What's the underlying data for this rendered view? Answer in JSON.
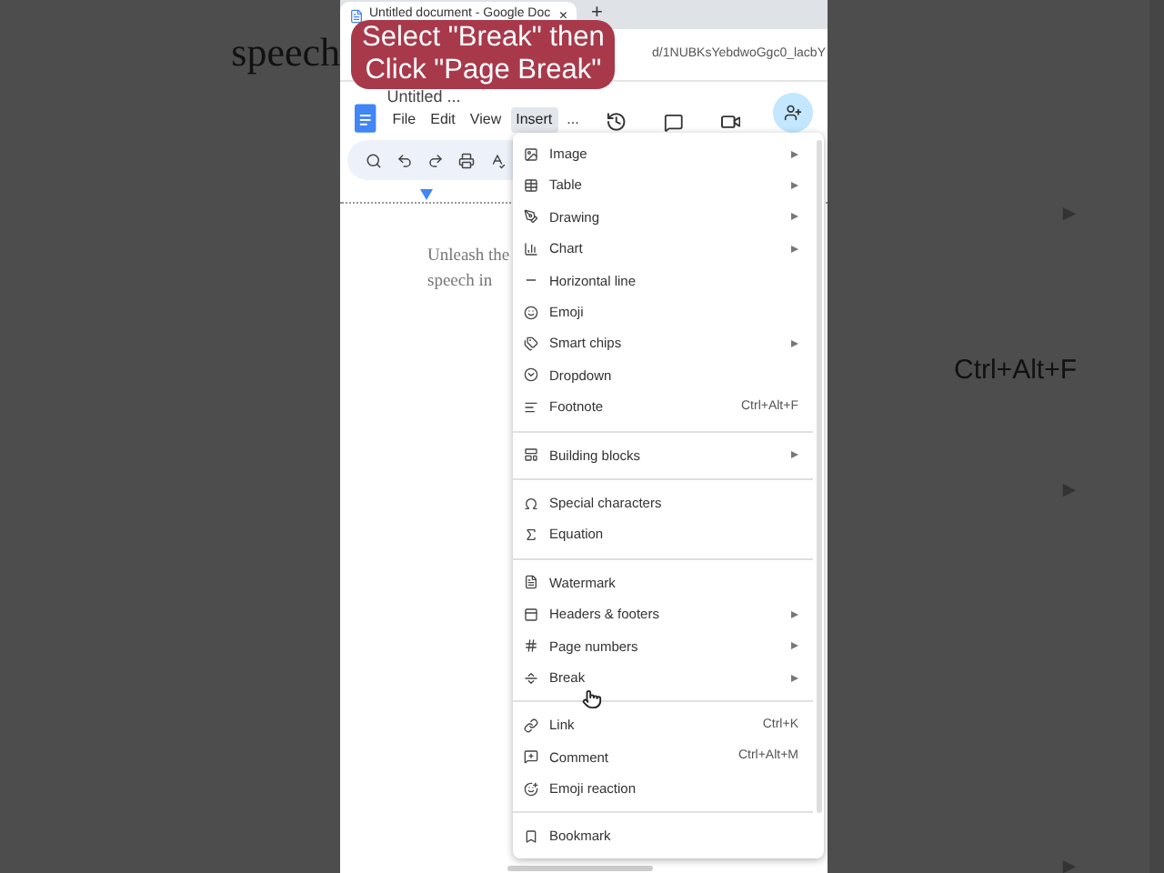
{
  "background": {
    "left_text": "speech",
    "right_shortcut": "Ctrl+Alt+F"
  },
  "browser": {
    "tab_title": "Untitled document - Google Doc",
    "tab_close": "×",
    "new_tab": "+",
    "address": "d/1NUBKsYebdwoGgc0_lacbY"
  },
  "caption": [
    "Select \"Break\" then",
    "Click \"Page Break\""
  ],
  "docs": {
    "title": "Untitled ...",
    "menus": [
      {
        "label": "File",
        "selected": false
      },
      {
        "label": "Edit",
        "selected": false
      },
      {
        "label": "View",
        "selected": false
      },
      {
        "label": "Insert",
        "selected": true
      },
      {
        "label": "...",
        "selected": false
      }
    ]
  },
  "document": {
    "lines": [
      "Unleash the",
      "speech in"
    ]
  },
  "insert_menu": {
    "groups": [
      [
        {
          "label": "Image",
          "submenu": true
        },
        {
          "label": "Table",
          "submenu": true
        },
        {
          "label": "Drawing",
          "submenu": true
        },
        {
          "label": "Chart",
          "submenu": true
        },
        {
          "label": "Horizontal line",
          "submenu": false
        },
        {
          "label": "Emoji",
          "submenu": false
        },
        {
          "label": "Smart chips",
          "submenu": true
        },
        {
          "label": "Dropdown",
          "submenu": false
        },
        {
          "label": "Footnote",
          "submenu": false,
          "shortcut": "Ctrl+Alt+F"
        }
      ],
      [
        {
          "label": "Building blocks",
          "submenu": true
        }
      ],
      [
        {
          "label": "Special characters",
          "submenu": false
        },
        {
          "label": "Equation",
          "submenu": false
        }
      ],
      [
        {
          "label": "Watermark",
          "submenu": false
        },
        {
          "label": "Headers & footers",
          "submenu": true
        },
        {
          "label": "Page numbers",
          "submenu": true
        },
        {
          "label": "Break",
          "submenu": true
        }
      ],
      [
        {
          "label": "Link",
          "submenu": false,
          "shortcut": "Ctrl+K"
        },
        {
          "label": "Comment",
          "submenu": false,
          "shortcut": "Ctrl+Alt+M"
        },
        {
          "label": "Emoji reaction",
          "submenu": false
        }
      ],
      [
        {
          "label": "Bookmark",
          "submenu": false
        }
      ]
    ]
  }
}
